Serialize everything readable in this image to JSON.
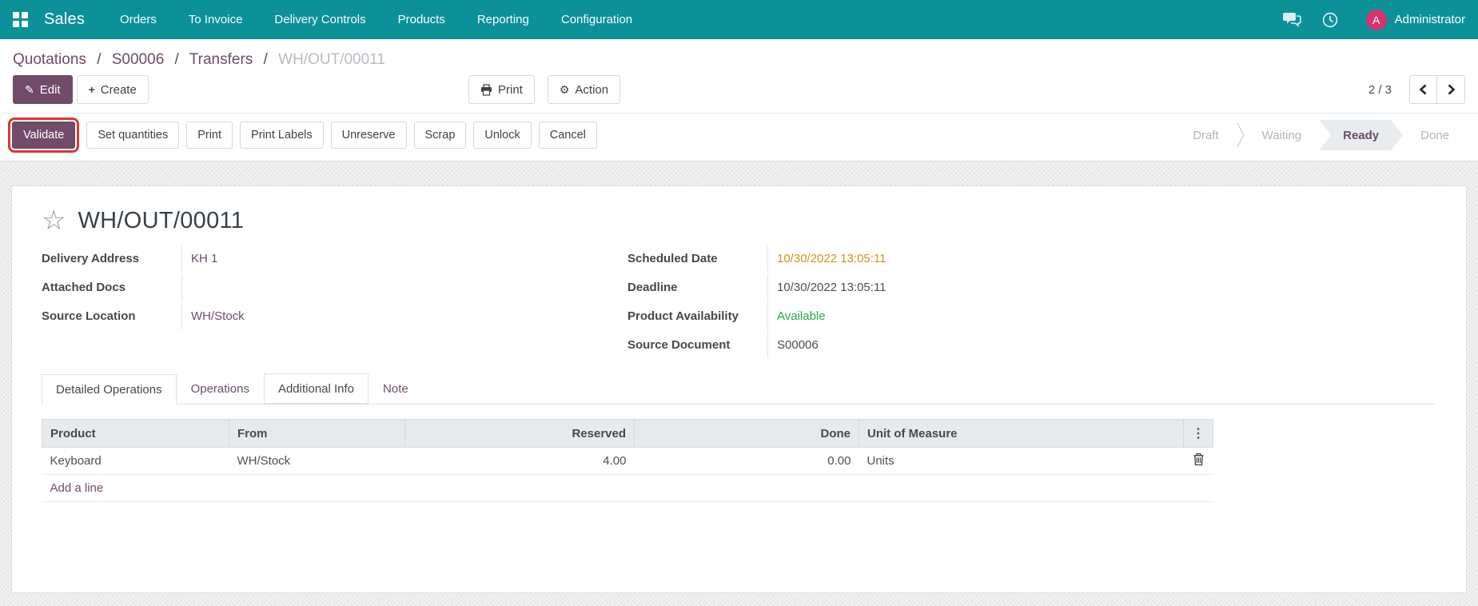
{
  "colors": {
    "topbar_teal": "#0d9199",
    "primary_purple": "#714b67",
    "highlight_red": "#da3832",
    "warning_amber": "#c7951d",
    "success_green": "#28a745",
    "avatar_pink": "#d63373"
  },
  "navbar": {
    "app_name": "Sales",
    "items": [
      {
        "label": "Orders"
      },
      {
        "label": "To Invoice"
      },
      {
        "label": "Delivery Controls"
      },
      {
        "label": "Products"
      },
      {
        "label": "Reporting"
      },
      {
        "label": "Configuration"
      }
    ],
    "user": {
      "name": "Administrator",
      "avatar_initial": "A"
    }
  },
  "breadcrumb": {
    "separator": "/",
    "links": [
      {
        "label": "Quotations"
      },
      {
        "label": "S00006"
      },
      {
        "label": "Transfers"
      }
    ],
    "current": "WH/OUT/00011"
  },
  "control_panel": {
    "edit_label": "Edit",
    "create_label": "Create",
    "print_label": "Print",
    "action_label": "Action",
    "pager": {
      "text": "2 / 3"
    }
  },
  "statusbar": {
    "buttons": [
      {
        "label": "Validate"
      },
      {
        "label": "Set quantities"
      },
      {
        "label": "Print"
      },
      {
        "label": "Print Labels"
      },
      {
        "label": "Unreserve"
      },
      {
        "label": "Scrap"
      },
      {
        "label": "Unlock"
      },
      {
        "label": "Cancel"
      }
    ],
    "stages": [
      {
        "label": "Draft"
      },
      {
        "label": "Waiting"
      },
      {
        "label": "Ready",
        "active": true
      },
      {
        "label": "Done"
      }
    ]
  },
  "form": {
    "title": "WH/OUT/00011",
    "fields_left": [
      {
        "label": "Delivery Address",
        "value": "KH 1"
      },
      {
        "label": "Attached Docs",
        "value": ""
      },
      {
        "label": "Source Location",
        "value": "WH/Stock"
      }
    ],
    "fields_right": [
      {
        "label": "Scheduled Date",
        "value": "10/30/2022 13:05:11"
      },
      {
        "label": "Deadline",
        "value": "10/30/2022 13:05:11"
      },
      {
        "label": "Product Availability",
        "value": "Available"
      },
      {
        "label": "Source Document",
        "value": "S00006"
      }
    ],
    "tabs": [
      {
        "label": "Detailed Operations"
      },
      {
        "label": "Operations"
      },
      {
        "label": "Additional Info"
      },
      {
        "label": "Note"
      }
    ],
    "table": {
      "headers": [
        "Product",
        "From",
        "Reserved",
        "Done",
        "Unit of Measure"
      ],
      "rows": [
        {
          "product": "Keyboard",
          "from": "WH/Stock",
          "reserved": "4.00",
          "done": "0.00",
          "uom": "Units"
        }
      ],
      "add_line_label": "Add a line"
    }
  },
  "icons": {
    "star": "☆",
    "kebab": "⋮",
    "pencil": "✎",
    "plus": "+",
    "gear": "⚙"
  }
}
